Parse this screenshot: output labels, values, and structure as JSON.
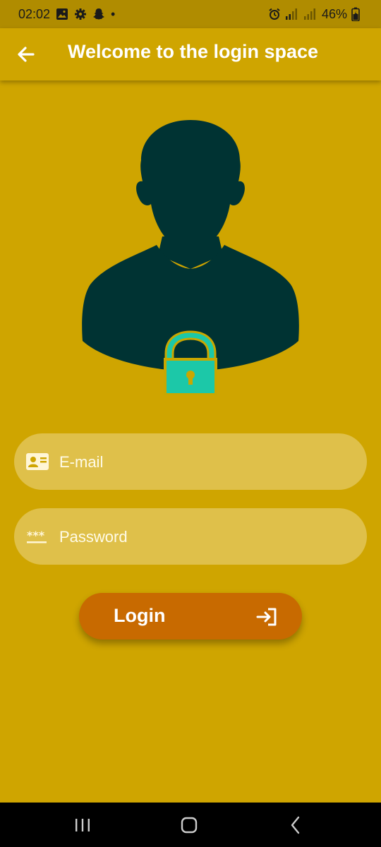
{
  "status_bar": {
    "time": "02:02",
    "dot": "•",
    "battery": "46%",
    "icons_left": [
      "image-icon",
      "gear-icon",
      "snapchat-icon"
    ],
    "icons_right": [
      "alarm-icon",
      "signal-icon",
      "signal-icon",
      "battery-icon"
    ]
  },
  "app_bar": {
    "title": "Welcome to the login space",
    "back_icon": "arrow-left-icon"
  },
  "avatar": {
    "icon": "user-lock-icon",
    "colors": {
      "person": "#003333",
      "lock": "#1cc8a8"
    }
  },
  "form": {
    "email": {
      "placeholder": "E-mail",
      "value": "",
      "icon": "id-card-icon"
    },
    "password": {
      "placeholder": "Password",
      "value": "",
      "icon": "password-icon"
    }
  },
  "login_button": {
    "label": "Login",
    "icon": "sign-in-icon"
  },
  "nav_bar": {
    "buttons": [
      "recents-icon",
      "home-icon",
      "back-icon"
    ]
  },
  "colors": {
    "background": "#cfa500",
    "status_bar": "#b08c00",
    "field": "#dfc04a",
    "button": "#c86a00"
  }
}
